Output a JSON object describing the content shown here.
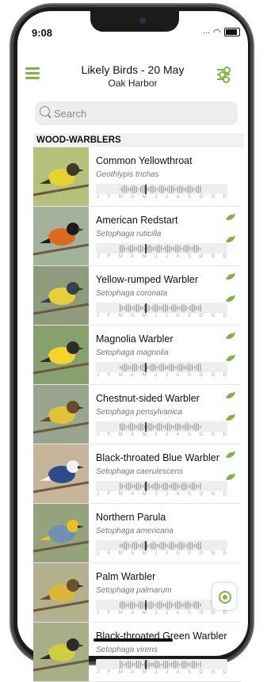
{
  "status": {
    "time": "9:08"
  },
  "header": {
    "title": "Likely Birds - 20 May",
    "subtitle": "Oak Harbor"
  },
  "search": {
    "placeholder": "Search"
  },
  "section": {
    "title": "WOOD-WARBLERS"
  },
  "month_labels": [
    "J",
    "F",
    "M",
    "A",
    "M",
    "J",
    "J",
    "A",
    "S",
    "O",
    "N",
    "D"
  ],
  "accent_color": "#7cb342",
  "birds": [
    {
      "name": "Common Yellowthroat",
      "latin": "Geothlypis trichas"
    },
    {
      "name": "American Redstart",
      "latin": "Setophaga ruticilla"
    },
    {
      "name": "Yellow-rumped Warbler",
      "latin": "Setophaga coronata"
    },
    {
      "name": "Magnolia Warbler",
      "latin": "Setophaga magnolia"
    },
    {
      "name": "Chestnut-sided Warbler",
      "latin": "Setophaga pensylvanica"
    },
    {
      "name": "Black-throated Blue Warbler",
      "latin": "Setophaga caerulescens"
    },
    {
      "name": "Northern Parula",
      "latin": "Setophaga americana"
    },
    {
      "name": "Palm Warbler",
      "latin": "Setophaga palmarum"
    },
    {
      "name": "Black-throated Green Warbler",
      "latin": "Setophaga virens"
    }
  ]
}
